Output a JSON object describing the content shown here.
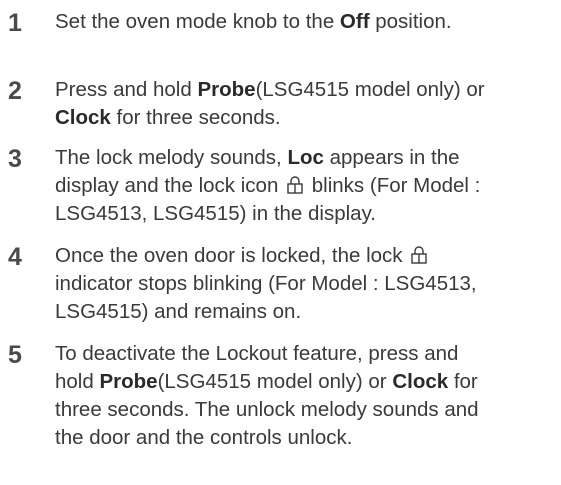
{
  "steps": [
    {
      "number": "1",
      "lines": [
        [
          "Set the oven mode knob to the ",
          {
            "b": "Off"
          },
          " position."
        ]
      ]
    },
    {
      "number": "2",
      "lines": [
        [
          "Press and hold ",
          {
            "b": "Probe"
          },
          "(LSG4515 model only) or"
        ],
        [
          {
            "b": "Clock"
          },
          " for three seconds."
        ]
      ]
    },
    {
      "number": "3",
      "lines": [
        [
          "The lock melody sounds, ",
          {
            "b": "Loc"
          },
          " appears in the"
        ],
        [
          "display and the lock icon ",
          {
            "icon": "lock-icon"
          },
          " blinks (For Model :"
        ],
        [
          "LSG4513, LSG4515) in the display."
        ]
      ]
    },
    {
      "number": "4",
      "lines": [
        [
          "Once the oven door is locked, the lock ",
          {
            "icon": "lock-icon"
          }
        ],
        [
          "indicator stops blinking (For Model : LSG4513,"
        ],
        [
          "LSG4515) and remains on."
        ]
      ]
    },
    {
      "number": "5",
      "lines": [
        [
          "To deactivate the Lockout feature, press and"
        ],
        [
          "hold ",
          {
            "b": "Probe"
          },
          "(LSG4515 model only) or ",
          {
            "b": "Clock"
          },
          " for"
        ],
        [
          "three seconds. The unlock melody sounds and"
        ],
        [
          "the door and the controls unlock."
        ]
      ]
    }
  ]
}
